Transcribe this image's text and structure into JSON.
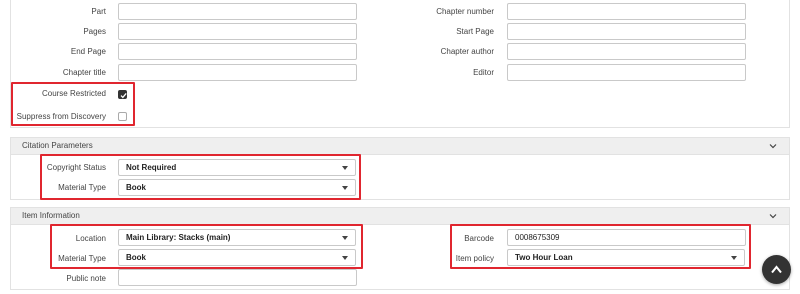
{
  "source_form": {
    "part_label": "Part",
    "pages_label": "Pages",
    "end_page_label": "End Page",
    "chapter_title_label": "Chapter title",
    "chapter_number_label": "Chapter number",
    "start_page_label": "Start Page",
    "chapter_author_label": "Chapter author",
    "editor_label": "Editor",
    "course_restricted_label": "Course Restricted",
    "course_restricted_checked": true,
    "suppress_label": "Suppress from Discovery",
    "suppress_checked": false
  },
  "citation_parameters": {
    "title": "Citation Parameters",
    "copyright_status_label": "Copyright Status",
    "copyright_status_value": "Not Required",
    "material_type_label": "Material Type",
    "material_type_value": "Book"
  },
  "item_information": {
    "title": "Item Information",
    "location_label": "Location",
    "location_value": "Main Library: Stacks (main)",
    "material_type_label": "Material Type",
    "material_type_value": "Book",
    "public_note_label": "Public note",
    "barcode_label": "Barcode",
    "barcode_value": "0008675309",
    "item_policy_label": "Item policy",
    "item_policy_value": "Two Hour Loan"
  },
  "icons": {
    "panel_toggle": "chevron-down-icon",
    "scroll_top": "arrow-up-icon",
    "checkbox_check": "check-icon"
  },
  "colors": {
    "highlight": "#e0262f",
    "panel_header_bg": "#efefef",
    "scroll_button_bg": "#333333"
  }
}
